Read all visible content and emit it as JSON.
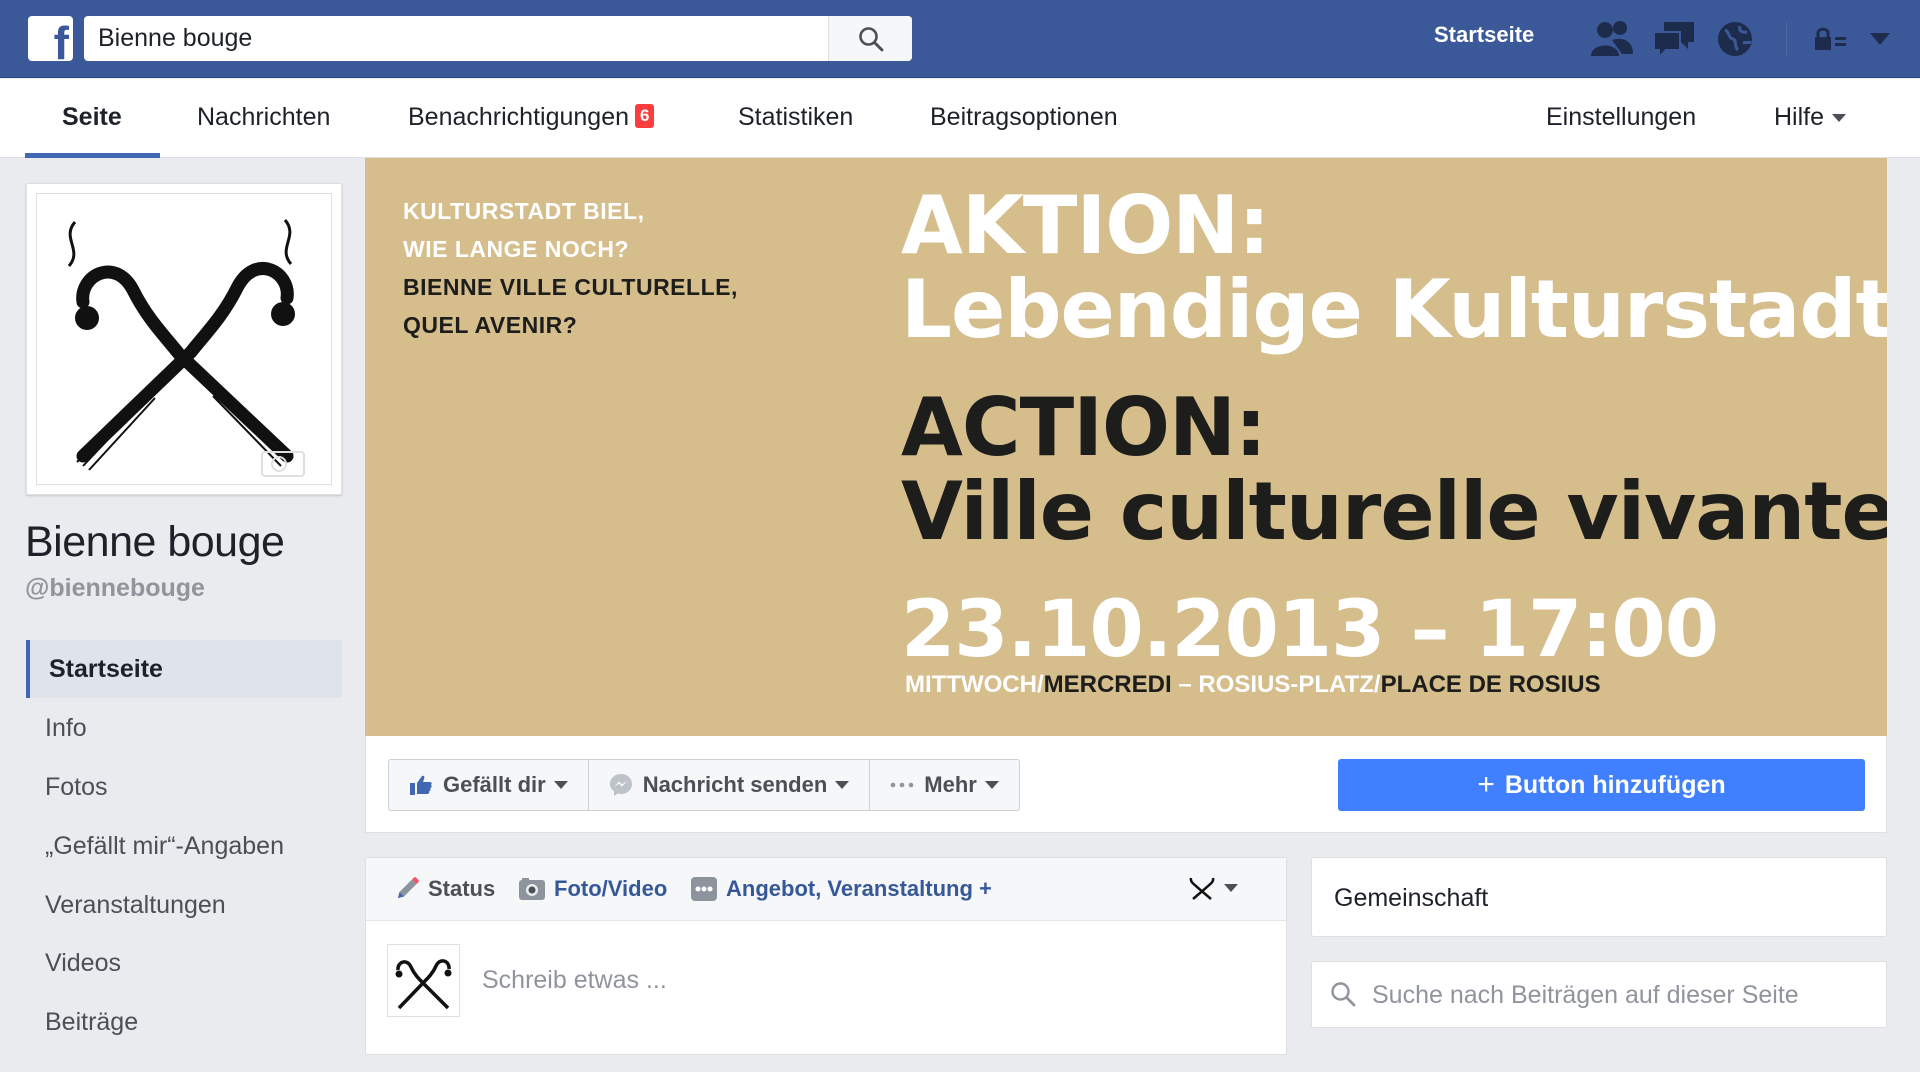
{
  "topbar": {
    "logo": "f",
    "search_value": "Bienne bouge",
    "home_label": "Startseite",
    "icons": [
      "search-icon",
      "friends-icon",
      "messages-icon",
      "notifications-globe-icon",
      "privacy-lock-icon",
      "account-menu-caret-icon"
    ]
  },
  "pagenav": {
    "tabs": [
      {
        "label": "Seite"
      },
      {
        "label": "Nachrichten"
      },
      {
        "label": "Benachrichtigungen",
        "badge": "6"
      },
      {
        "label": "Statistiken"
      },
      {
        "label": "Beitragsoptionen"
      }
    ],
    "right_tabs": [
      {
        "label": "Einstellungen"
      },
      {
        "label": "Hilfe"
      }
    ]
  },
  "page": {
    "name": "Bienne bouge",
    "handle": "@biennebouge"
  },
  "sidebar": {
    "items": [
      {
        "label": "Startseite"
      },
      {
        "label": "Info"
      },
      {
        "label": "Fotos"
      },
      {
        "label": "„Gefällt mir“-Angaben"
      },
      {
        "label": "Veranstaltungen"
      },
      {
        "label": "Videos"
      },
      {
        "label": "Beiträge"
      }
    ]
  },
  "cover": {
    "q1_line1": "KULTURSTADT BIEL,",
    "q1_line2": "WIE LANGE NOCH?",
    "q2_line1": "BIENNE VILLE CULTURELLE,",
    "q2_line2": "QUEL AVENIR?",
    "h1_line1": "AKTION:",
    "h1_line2": "Lebendige Kulturstadt.",
    "h2_line1": "ACTION:",
    "h2_line2": "Ville culturelle vivante.",
    "date": "23.10.2013 – 17:00",
    "sub_day_de": "MITTWOCH/",
    "sub_day_fr": "MERCREDI",
    "sub_place_de": " – ROSIUS-PLATZ/",
    "sub_place_fr": "PLACE DE ROSIUS",
    "background": "#d5bd8c"
  },
  "actions": {
    "like_label": "Gefällt dir",
    "message_label": "Nachricht senden",
    "more_label": "Mehr",
    "add_button_label": "Button hinzufügen",
    "add_button_plus": "+"
  },
  "composer": {
    "status_label": "Status",
    "photo_label": "Foto/Video",
    "offer_label": "Angebot, Veranstaltung +",
    "placeholder": "Schreib etwas ..."
  },
  "right": {
    "community_label": "Gemeinschaft",
    "search_placeholder": "Suche nach Beiträgen auf dieser Seite"
  },
  "colors": {
    "brand": "#3b5998",
    "accent": "#4267b2",
    "button_blue": "#4080ff",
    "badge_red": "#fa3e3e",
    "cover_tan": "#d5bd8c"
  }
}
